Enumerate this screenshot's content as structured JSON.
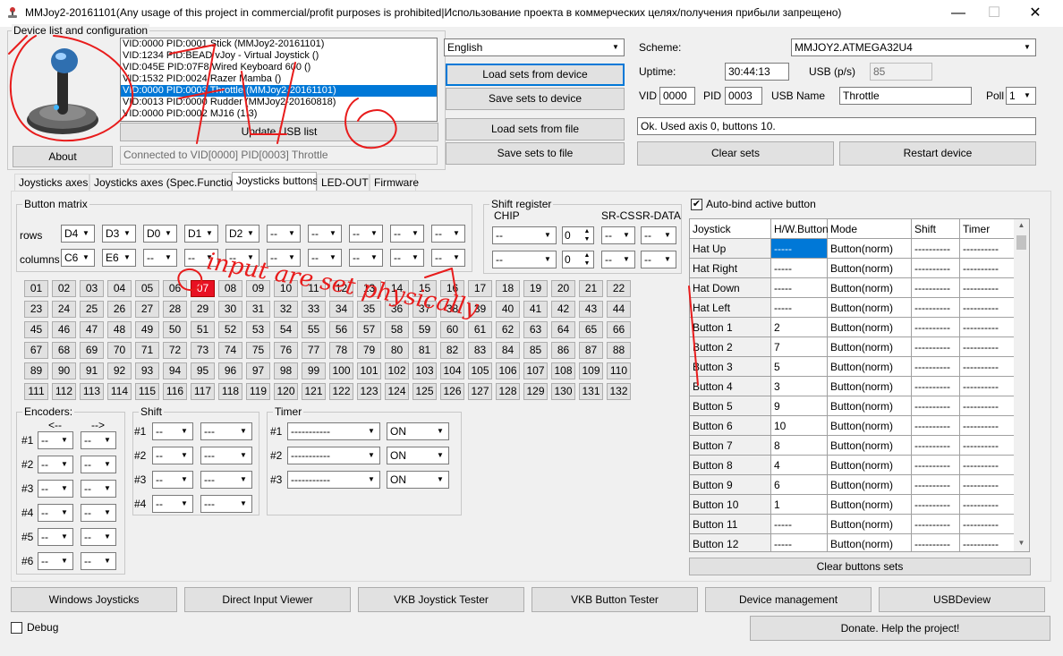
{
  "window": {
    "title": "MMJoy2-20161101(Any usage of this project in commercial/profit purposes is prohibited|Использование проекта в коммерческих целях/получения прибыли запрещено)",
    "minimize": "—",
    "maximize": "☐",
    "close": "✕"
  },
  "device_group": {
    "legend": "Device list and configuration",
    "devices": [
      "VID:0000 PID:0001 Stick (MMJoy2-20161101)",
      "VID:1234 PID:BEAD vJoy - Virtual Joystick ()",
      "VID:045E PID:07F8 Wired Keyboard 600 ()",
      "VID:1532 PID:0024 Razer Mamba ()",
      "VID:0000 PID:0003 Throttle (MMJoy2-20161101)",
      "VID:0013 PID:0000 Rudder (MMJoy2-20160818)",
      "VID:0000 PID:0002 MJ16 (1.3)"
    ],
    "selected_index": 4,
    "update_usb": "Update USB list",
    "about": "About",
    "connected": "Connected to VID[0000] PID[0003] Throttle"
  },
  "center": {
    "language": "English",
    "load_device": "Load sets from device",
    "save_device": "Save sets to device",
    "load_file": "Load sets from file",
    "save_file": "Save sets to file"
  },
  "right": {
    "scheme_label": "Scheme:",
    "scheme": "MMJOY2.ATMEGA32U4",
    "uptime_label": "Uptime:",
    "uptime": "30:44:13",
    "usb_label": "USB (p/s)",
    "usb": "85",
    "vid_label": "VID",
    "vid": "0000",
    "pid_label": "PID",
    "pid": "0003",
    "usbname_label": "USB Name",
    "usbname": "Throttle",
    "poll_label": "Poll",
    "poll": "1",
    "status": "Ok. Used axis  0, buttons 10.",
    "clear_sets": "Clear sets",
    "restart": "Restart device"
  },
  "tabs": [
    "Joysticks axes",
    "Joysticks axes (Spec.Functions)",
    "Joysticks buttons",
    "LED-OUT",
    "Firmware"
  ],
  "active_tab": 2,
  "matrix": {
    "legend": "Button matrix",
    "rows_label": "rows",
    "columns_label": "columns",
    "rows": [
      "D4",
      "D3",
      "D0",
      "D1",
      "D2",
      "--",
      "--",
      "--",
      "--",
      "--"
    ],
    "columns": [
      "C6",
      "E6",
      "--",
      "--",
      "--",
      "--",
      "--",
      "--",
      "--",
      "--"
    ]
  },
  "shift_register": {
    "legend": "Shift register",
    "chip_label": "CHIP",
    "srcs_label": "SR-CS",
    "srdata_label": "SR-DATA",
    "rows": [
      {
        "chip": "--",
        "num": "0",
        "cs": "--",
        "data": "--"
      },
      {
        "chip": "--",
        "num": "0",
        "cs": "--",
        "data": "--"
      }
    ]
  },
  "buttons": {
    "labels": [
      "01",
      "02",
      "03",
      "04",
      "05",
      "06",
      "07",
      "08",
      "09",
      "10",
      "11",
      "12",
      "13",
      "14",
      "15",
      "16",
      "17",
      "18",
      "19",
      "20",
      "21",
      "22",
      "23",
      "24",
      "25",
      "26",
      "27",
      "28",
      "29",
      "30",
      "31",
      "32",
      "33",
      "34",
      "35",
      "36",
      "37",
      "38",
      "39",
      "40",
      "41",
      "42",
      "43",
      "44",
      "45",
      "46",
      "47",
      "48",
      "49",
      "50",
      "51",
      "52",
      "53",
      "54",
      "55",
      "56",
      "57",
      "58",
      "59",
      "60",
      "61",
      "62",
      "63",
      "64",
      "65",
      "66",
      "67",
      "68",
      "69",
      "70",
      "71",
      "72",
      "73",
      "74",
      "75",
      "76",
      "77",
      "78",
      "79",
      "80",
      "81",
      "82",
      "83",
      "84",
      "85",
      "86",
      "87",
      "88",
      "89",
      "90",
      "91",
      "92",
      "93",
      "94",
      "95",
      "96",
      "97",
      "98",
      "99",
      "100",
      "101",
      "102",
      "103",
      "104",
      "105",
      "106",
      "107",
      "108",
      "109",
      "110",
      "111",
      "112",
      "113",
      "114",
      "115",
      "116",
      "117",
      "118",
      "119",
      "120",
      "121",
      "122",
      "123",
      "124",
      "125",
      "126",
      "127",
      "128",
      "129",
      "130",
      "131",
      "132"
    ],
    "highlighted_index": 6
  },
  "encoders": {
    "legend": "Encoders:",
    "left_arrow": "<--",
    "right_arrow": "-->",
    "rows": [
      {
        "label": "#1",
        "a": "--",
        "b": "--"
      },
      {
        "label": "#2",
        "a": "--",
        "b": "--"
      },
      {
        "label": "#3",
        "a": "--",
        "b": "--"
      },
      {
        "label": "#4",
        "a": "--",
        "b": "--"
      },
      {
        "label": "#5",
        "a": "--",
        "b": "--"
      },
      {
        "label": "#6",
        "a": "--",
        "b": "--"
      }
    ]
  },
  "shift": {
    "legend": "Shift",
    "rows": [
      {
        "label": "#1",
        "a": "--",
        "b": "---"
      },
      {
        "label": "#2",
        "a": "--",
        "b": "---"
      },
      {
        "label": "#3",
        "a": "--",
        "b": "---"
      },
      {
        "label": "#4",
        "a": "--",
        "b": "---"
      }
    ]
  },
  "timer": {
    "legend": "Timer",
    "rows": [
      {
        "label": "#1",
        "a": "-----------",
        "b": "ON"
      },
      {
        "label": "#2",
        "a": "-----------",
        "b": "ON"
      },
      {
        "label": "#3",
        "a": "-----------",
        "b": "ON"
      }
    ]
  },
  "autobind": {
    "label": "Auto-bind active button",
    "checked": "✔"
  },
  "grid": {
    "headers": [
      "Joystick",
      "H/W.Button",
      "Mode",
      "Shift",
      "Timer"
    ],
    "rows": [
      {
        "name": "Hat Up",
        "hw": "-----",
        "mode": "Button(norm)",
        "shift": "----------",
        "timer": "----------"
      },
      {
        "name": "Hat Right",
        "hw": "-----",
        "mode": "Button(norm)",
        "shift": "----------",
        "timer": "----------"
      },
      {
        "name": "Hat Down",
        "hw": "-----",
        "mode": "Button(norm)",
        "shift": "----------",
        "timer": "----------"
      },
      {
        "name": "Hat Left",
        "hw": "-----",
        "mode": "Button(norm)",
        "shift": "----------",
        "timer": "----------"
      },
      {
        "name": "Button 1",
        "hw": "2",
        "mode": "Button(norm)",
        "shift": "----------",
        "timer": "----------"
      },
      {
        "name": "Button 2",
        "hw": "7",
        "mode": "Button(norm)",
        "shift": "----------",
        "timer": "----------"
      },
      {
        "name": "Button 3",
        "hw": "5",
        "mode": "Button(norm)",
        "shift": "----------",
        "timer": "----------"
      },
      {
        "name": "Button 4",
        "hw": "3",
        "mode": "Button(norm)",
        "shift": "----------",
        "timer": "----------"
      },
      {
        "name": "Button 5",
        "hw": "9",
        "mode": "Button(norm)",
        "shift": "----------",
        "timer": "----------"
      },
      {
        "name": "Button 6",
        "hw": "10",
        "mode": "Button(norm)",
        "shift": "----------",
        "timer": "----------"
      },
      {
        "name": "Button 7",
        "hw": "8",
        "mode": "Button(norm)",
        "shift": "----------",
        "timer": "----------"
      },
      {
        "name": "Button 8",
        "hw": "4",
        "mode": "Button(norm)",
        "shift": "----------",
        "timer": "----------"
      },
      {
        "name": "Button 9",
        "hw": "6",
        "mode": "Button(norm)",
        "shift": "----------",
        "timer": "----------"
      },
      {
        "name": "Button 10",
        "hw": "1",
        "mode": "Button(norm)",
        "shift": "----------",
        "timer": "----------"
      },
      {
        "name": "Button 11",
        "hw": "-----",
        "mode": "Button(norm)",
        "shift": "----------",
        "timer": "----------"
      },
      {
        "name": "Button 12",
        "hw": "-----",
        "mode": "Button(norm)",
        "shift": "----------",
        "timer": "----------"
      }
    ],
    "clear": "Clear buttons sets"
  },
  "bottom": {
    "buttons": [
      "Windows Joysticks",
      "Direct Input Viewer",
      "VKB Joystick Tester",
      "VKB Button Tester",
      "Device management",
      "USBDeview"
    ],
    "debug_label": "Debug",
    "donate": "Donate. Help the project!"
  },
  "annotation": {
    "text": "input are set physically",
    "color": "#e81c1c"
  },
  "colors": {
    "accent": "#0078d7",
    "highlight_button": "#e81123"
  }
}
